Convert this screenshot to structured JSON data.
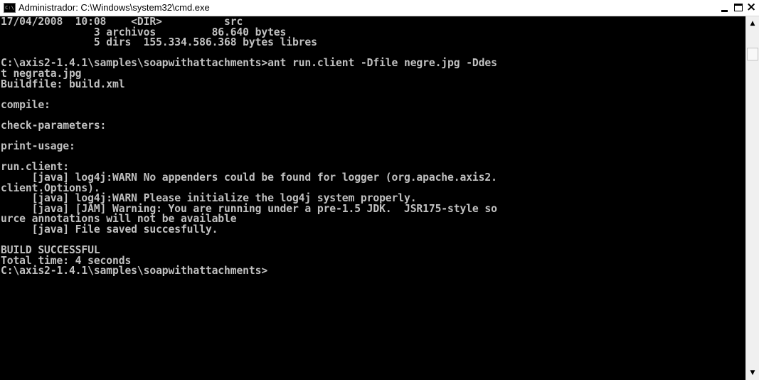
{
  "window": {
    "title": "Administrador: C:\\Windows\\system32\\cmd.exe",
    "icon": "cmd-icon",
    "controls": {
      "minimize": "minimize-icon",
      "maximize": "maximize-icon",
      "close": "close-icon",
      "close_glyph": "×"
    }
  },
  "console": {
    "lines": [
      "17/04/2008  10:08    <DIR>          src",
      "               3 archivos         86.640 bytes",
      "               5 dirs  155.334.586.368 bytes libres",
      "",
      "C:\\axis2-1.4.1\\samples\\soapwithattachments>ant run.client -Dfile negre.jpg -Ddes",
      "t negrata.jpg",
      "Buildfile: build.xml",
      "",
      "compile:",
      "",
      "check-parameters:",
      "",
      "print-usage:",
      "",
      "run.client:",
      "     [java] log4j:WARN No appenders could be found for logger (org.apache.axis2.",
      "client.Options).",
      "     [java] log4j:WARN Please initialize the log4j system properly.",
      "     [java] [JAM] Warning: You are running under a pre-1.5 JDK.  JSR175-style so",
      "urce annotations will not be available",
      "     [java] File saved succesfully.",
      "",
      "BUILD SUCCESSFUL",
      "Total time: 4 seconds",
      "C:\\axis2-1.4.1\\samples\\soapwithattachments>"
    ],
    "colors": {
      "background": "#000000",
      "foreground": "#c0c0c0"
    }
  },
  "scrollbar": {
    "up_glyph": "▲",
    "down_glyph": "▼",
    "up_icon": "scroll-up-arrow-icon",
    "down_icon": "scroll-down-arrow-icon"
  },
  "icon_labels": {
    "cmd": "C:\\"
  }
}
